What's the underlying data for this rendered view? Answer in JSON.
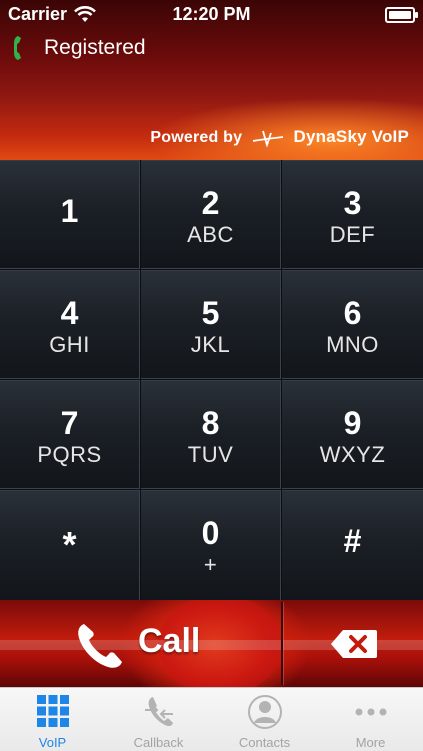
{
  "status_bar": {
    "carrier": "Carrier",
    "time": "12:20 PM"
  },
  "registration": {
    "status": "Registered"
  },
  "branding": {
    "powered_by": "Powered by",
    "brand": "DynaSky VoIP"
  },
  "keypad": {
    "keys": [
      {
        "digit": "1",
        "letters": ""
      },
      {
        "digit": "2",
        "letters": "ABC"
      },
      {
        "digit": "3",
        "letters": "DEF"
      },
      {
        "digit": "4",
        "letters": "GHI"
      },
      {
        "digit": "5",
        "letters": "JKL"
      },
      {
        "digit": "6",
        "letters": "MNO"
      },
      {
        "digit": "7",
        "letters": "PQRS"
      },
      {
        "digit": "8",
        "letters": "TUV"
      },
      {
        "digit": "9",
        "letters": "WXYZ"
      },
      {
        "digit": "*",
        "letters": ""
      },
      {
        "digit": "0",
        "letters": "+"
      },
      {
        "digit": "#",
        "letters": ""
      }
    ]
  },
  "actions": {
    "call_label": "Call"
  },
  "tabs": [
    {
      "label": "VoIP",
      "icon": "keypad-grid-icon",
      "active": true
    },
    {
      "label": "Callback",
      "icon": "callback-icon",
      "active": false
    },
    {
      "label": "Contacts",
      "icon": "contacts-icon",
      "active": false
    },
    {
      "label": "More",
      "icon": "more-dots-icon",
      "active": false
    }
  ],
  "colors": {
    "accent": "#1e86e6",
    "registered_icon": "#2fb34a",
    "header_red": "#8f1812"
  }
}
